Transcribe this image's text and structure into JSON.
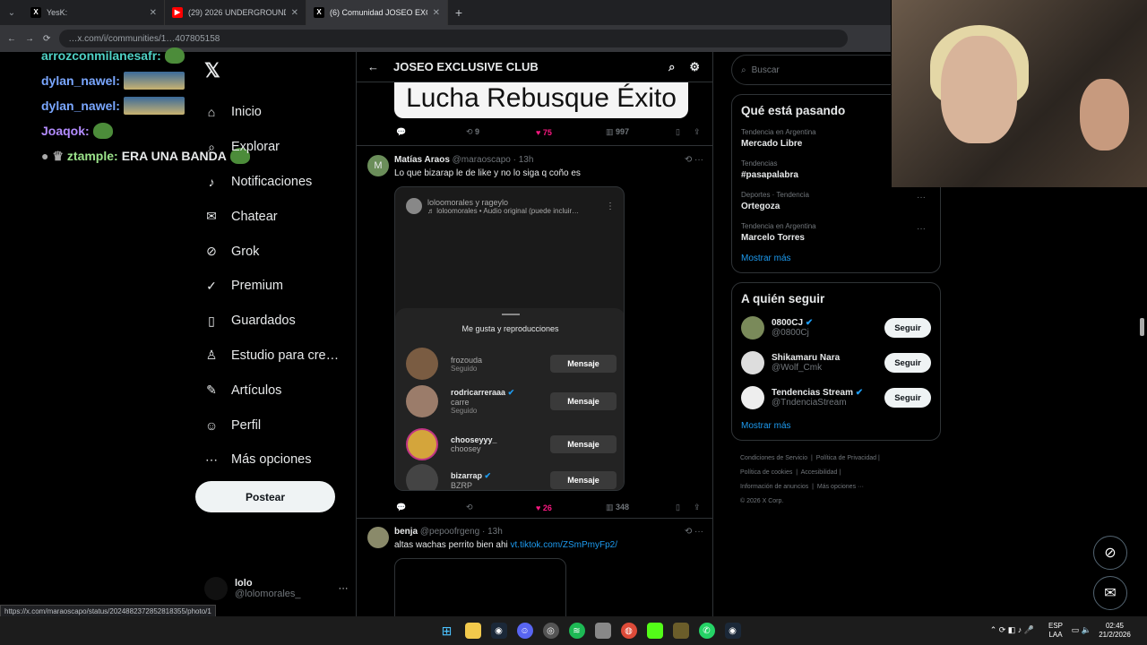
{
  "tabs": [
    {
      "label": "YesK:",
      "active": false
    },
    {
      "label": "(29) 2026 UNDERGROUND SO…",
      "active": false
    },
    {
      "label": "(6) Comunidad JOSEO EXCLU…",
      "active": true
    }
  ],
  "address": "…x.com/i/communities/1…407805158",
  "chat": [
    {
      "user": "arrozconmilanesafr:",
      "text": "",
      "color": "#4fd1c5"
    },
    {
      "user": "dylan_nawel:",
      "text": "",
      "color": "#7aa7ff"
    },
    {
      "user": "dylan_nawel:",
      "text": "",
      "color": "#7aa7ff"
    },
    {
      "user": "Joaqok:",
      "text": "",
      "color": "#b38cff"
    },
    {
      "user": "ztample:",
      "text": "ERA UNA BANDA",
      "color": "#9be38b"
    }
  ],
  "nav": {
    "logo": "𝕏",
    "items": [
      {
        "label": "Inicio",
        "icon": "home-icon",
        "glyph": "⌂"
      },
      {
        "label": "Explorar",
        "icon": "search-icon",
        "glyph": "⌕"
      },
      {
        "label": "Notificaciones",
        "icon": "bell-icon",
        "glyph": "♪"
      },
      {
        "label": "Chatear",
        "icon": "mail-icon",
        "glyph": "✉"
      },
      {
        "label": "Grok",
        "icon": "grok-icon",
        "glyph": "⊘"
      },
      {
        "label": "Premium",
        "icon": "premium-icon",
        "glyph": "✓"
      },
      {
        "label": "Guardados",
        "icon": "bookmark-icon",
        "glyph": "▯"
      },
      {
        "label": "Estudio para cre…",
        "icon": "studio-icon",
        "glyph": "♙"
      },
      {
        "label": "Artículos",
        "icon": "article-icon",
        "glyph": "✎"
      },
      {
        "label": "Perfil",
        "icon": "person-icon",
        "glyph": "☺"
      },
      {
        "label": "Más opciones",
        "icon": "more-icon",
        "glyph": "⋯"
      }
    ],
    "post": "Postear",
    "profile": {
      "name": "lolo",
      "handle": "@lolomorales_"
    }
  },
  "main": {
    "title": "JOSEO EXCLUSIVE CLUB",
    "banner": "Lucha Rebusque Éxito",
    "top_actions": {
      "replies": "",
      "reposts": "9",
      "likes": "75",
      "views": "997"
    },
    "tweet1": {
      "name": "Matías Araos",
      "handle": "@maraoscapo",
      "time": "· 13h",
      "text": "Lo que bizarap le de like y no lo siga q coño es",
      "card": {
        "header": "loloomorales y rageylo",
        "audio": "♬ loloomorales • Audio original (puede incluir…",
        "sheet_title": "Me gusta y reproducciones",
        "rows": [
          {
            "name": "",
            "sub": "frozouda",
            "sub2": "Seguido",
            "btn": "Mensaje"
          },
          {
            "name": "rodricarreraaa",
            "sub": "carre",
            "sub2": "Seguido",
            "btn": "Mensaje"
          },
          {
            "name": "chooseyyy_",
            "sub": "choosey",
            "sub2": "",
            "btn": "Mensaje"
          },
          {
            "name": "bizarrap",
            "sub": "BZRP",
            "sub2": "",
            "btn": "Mensaje"
          }
        ]
      },
      "actions": {
        "replies": "",
        "reposts": "",
        "likes": "26",
        "views": "348"
      }
    },
    "tweet2": {
      "name": "benja",
      "handle": "@pepoofrgeng",
      "time": "· 13h",
      "text": "altas wachas perrito bien ahi ",
      "link": "vt.tiktok.com/ZSmPmyFp2/"
    }
  },
  "right": {
    "search_placeholder": "Buscar",
    "trends_title": "Qué está pasando",
    "trends": [
      {
        "cat": "Tendencia en Argentina",
        "name": "Mercado Libre"
      },
      {
        "cat": "Tendencias",
        "name": "#pasapalabra"
      },
      {
        "cat": "Deportes · Tendencia",
        "name": "Ortegoza"
      },
      {
        "cat": "Tendencia en Argentina",
        "name": "Marcelo Torres"
      }
    ],
    "show_more": "Mostrar más",
    "who_title": "A quién seguir",
    "who": [
      {
        "name": "0800CJ",
        "handle": "@0800Cj",
        "btn": "Seguir"
      },
      {
        "name": "Shikamaru Nara",
        "handle": "@Wolf_Cmk",
        "btn": "Seguir"
      },
      {
        "name": "Tendencias Stream",
        "handle": "@TndenciaStream",
        "btn": "Seguir"
      }
    ],
    "footer": [
      "Condiciones de Servicio",
      "Política de Privacidad",
      "Política de cookies",
      "Accesibilidad",
      "Información de anuncios",
      "Más opciones ···",
      "© 2026 X Corp."
    ]
  },
  "statusbar": "https://x.com/maraoscapo/status/2024882372852818355/photo/1",
  "tray": {
    "lang1": "ESP",
    "lang2": "LAA",
    "time": "02:45",
    "date": "21/2/2026"
  }
}
